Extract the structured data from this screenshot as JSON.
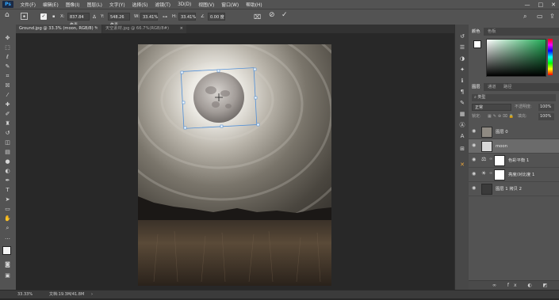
{
  "menu": {
    "items": [
      "文件(F)",
      "编辑(E)",
      "图像(I)",
      "图层(L)",
      "文字(Y)",
      "选择(S)",
      "滤镜(T)",
      "3D(D)",
      "视图(V)",
      "窗口(W)",
      "帮助(H)"
    ],
    "window_controls": [
      "—",
      "□",
      "✕"
    ]
  },
  "options_bar": {
    "x_label": "X:",
    "x_value": "837.84 像素",
    "y_label": "Y:",
    "y_value": "548.26 像素",
    "w_label": "W:",
    "w_value": "33.41%",
    "h_label": "H:",
    "h_value": "33.41%",
    "angle_value": "0.00",
    "angle_unit": "度"
  },
  "tabs": [
    {
      "label": "Ground.jpg @ 33.3% (moon, RGB/8) *",
      "close": "×",
      "active": true
    },
    {
      "label": "天空素材.jpg @ 66.7%(RGB/8#)",
      "close": "×",
      "active": false
    }
  ],
  "status_bar": {
    "zoom": "33.33%",
    "doc_info": "文档:19.3M/41.8M",
    "arrow": "›"
  },
  "color_panel": {
    "tabs": [
      "颜色",
      "色板"
    ],
    "hue_accent": "#1faa54"
  },
  "layers_panel": {
    "tabs": [
      "图层",
      "通道",
      "路径"
    ],
    "filter_label": "类型",
    "blend_mode": "正常",
    "opacity_label": "不透明度:",
    "opacity_value": "100%",
    "lock_label": "锁定:",
    "fill_label": "填充:",
    "fill_value": "100%",
    "layers": [
      {
        "name": "图层 0",
        "selected": false,
        "icon": "raster-thumb"
      },
      {
        "name": "moon",
        "selected": true,
        "icon": "raster-thumb"
      },
      {
        "name": "色彩平衡 1",
        "selected": false,
        "icon": "adjustment-balance"
      },
      {
        "name": "亮度/对比度 1",
        "selected": false,
        "icon": "adjustment-brightness"
      },
      {
        "name": "图层 1 拷贝 2",
        "selected": false,
        "icon": "raster-thumb"
      }
    ]
  }
}
